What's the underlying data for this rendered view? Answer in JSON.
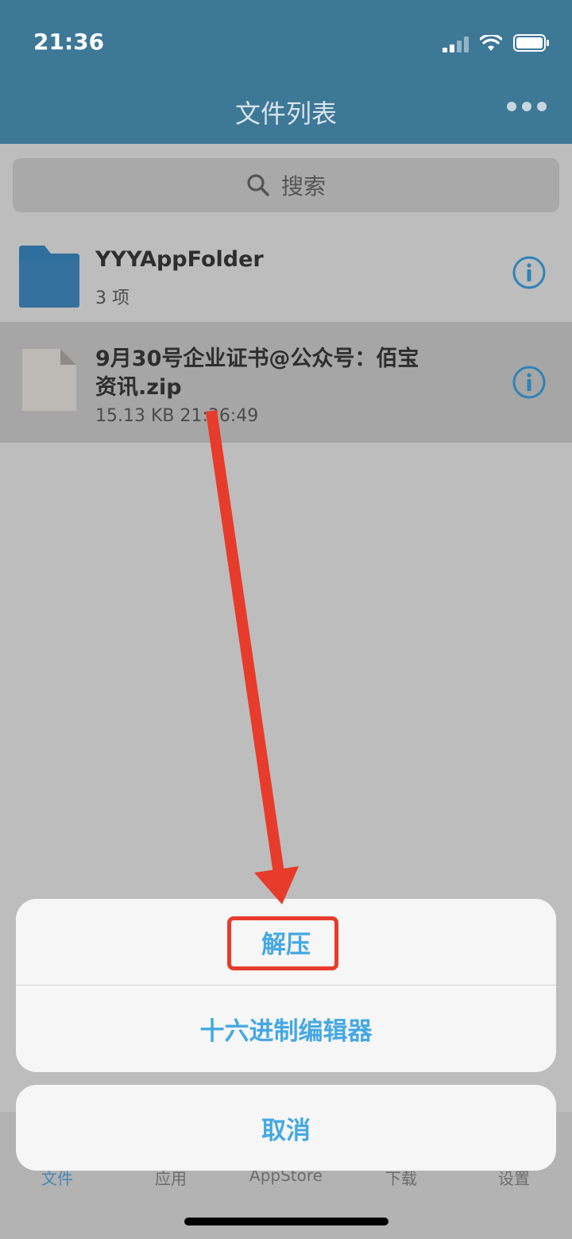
{
  "status": {
    "time": "21:36"
  },
  "header": {
    "title": "文件列表"
  },
  "search": {
    "placeholder": "搜索"
  },
  "files": [
    {
      "name": "YYYAppFolder",
      "meta": "3 项",
      "icon": "folder-icon"
    },
    {
      "name_line1": "9月30号企业证书@公众号：佰宝",
      "name_line2": "资讯.zip",
      "meta": "15.13 KB   21:36:49",
      "icon": "zip-file-icon"
    }
  ],
  "tabs": [
    "文件",
    "应用",
    "AppStore",
    "下载",
    "设置"
  ],
  "action_sheet": {
    "options": [
      "解压",
      "十六进制编辑器"
    ],
    "cancel": "取消"
  },
  "colors": {
    "header": "#3d7897",
    "accent": "#45a8e2",
    "annotation": "#e73b2b"
  }
}
